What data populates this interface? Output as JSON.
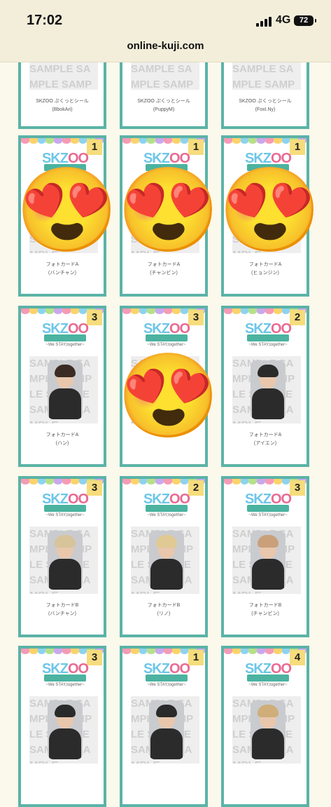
{
  "status": {
    "time": "17:02",
    "network": "4G",
    "battery": "72"
  },
  "browser": {
    "url": "online-kuji.com"
  },
  "colors": {
    "border": "#5bb3a7",
    "badge": "#f6dc7c",
    "bg": "#fbf8ec"
  },
  "logo": {
    "title_a": "SKZ",
    "title_b": "OO",
    "tagline": "~We STAY,together~"
  },
  "watermark": "SAMPLE SAMPLE SAMPLE SAMPLE SAMPLE SAMPLE",
  "top_row": [
    {
      "name": "SKZOO ぷくっとシール",
      "member": "(BbokAri)"
    },
    {
      "name": "SKZOO ぷくっとシール",
      "member": "(PuppyM)"
    },
    {
      "name": "SKZOO ぷくっとシール",
      "member": "(FoxI.Ny)"
    }
  ],
  "cards": [
    {
      "count": "1",
      "name": "フォトカードA",
      "member": "(バンチャン)",
      "emoji": "heart-eyes-emoji"
    },
    {
      "count": "1",
      "name": "フォトカードA",
      "member": "(チャンビン)",
      "emoji": "heart-eyes-emoji"
    },
    {
      "count": "1",
      "name": "フォトカードA",
      "member": "(ヒョンジン)",
      "emoji": "heart-eyes-emoji"
    },
    {
      "count": "3",
      "name": "フォトカードA",
      "member": "(ハン)"
    },
    {
      "count": "3",
      "name": "",
      "member": "",
      "emoji": "heart-eyes-emoji"
    },
    {
      "count": "2",
      "name": "フォトカードA",
      "member": "(アイエン)"
    },
    {
      "count": "3",
      "name": "フォトカードB",
      "member": "(バンチャン)"
    },
    {
      "count": "2",
      "name": "フォトカードB",
      "member": "(リノ)"
    },
    {
      "count": "3",
      "name": "フォトカードB",
      "member": "(チャンビン)"
    },
    {
      "count": "3",
      "name": "",
      "member": ""
    },
    {
      "count": "1",
      "name": "",
      "member": ""
    },
    {
      "count": "4",
      "name": "",
      "member": ""
    }
  ]
}
